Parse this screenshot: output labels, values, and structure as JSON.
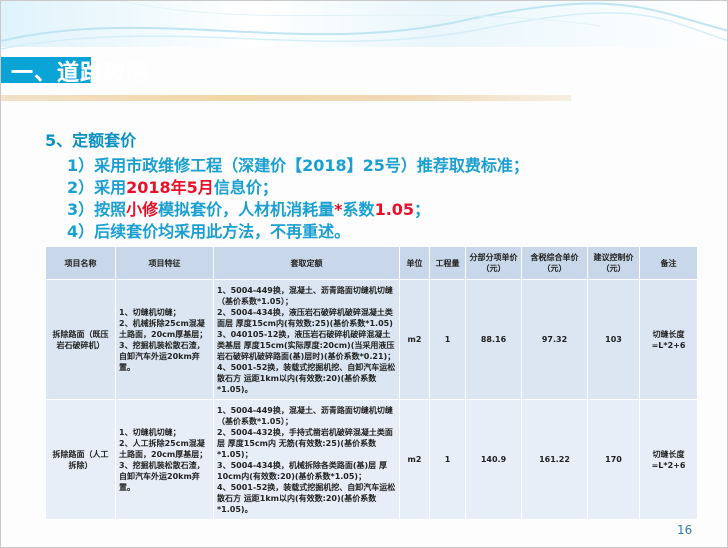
{
  "section_title": "一、道路破除",
  "subheading": "5、定额套价",
  "bullets": [
    {
      "prefix": "1）采用市政维修工程（深建价【2018】25号）推荐取费标准；"
    },
    {
      "prefix": "2）采用",
      "highlight": "2018年5月",
      "suffix": "信息价；"
    },
    {
      "prefix": "3）按照",
      "highlight": "小修",
      "middle": "模拟套价，人材机消耗量",
      "highlight2": "*",
      "middle2": "系数",
      "highlight3": "1.05",
      "suffix": "；"
    },
    {
      "prefix": "4）后续套价均采用此方法，不再重述。"
    }
  ],
  "table": {
    "headers": {
      "item_name": "项目名称",
      "item_feature": "项目特征",
      "quota": "套取定额",
      "unit": "单位",
      "quantity": "工程量",
      "sub_unit_price": "分部分项单价（元）",
      "composite_price": "含税综合单价（元）",
      "suggested_price": "建议控制价（元）",
      "remark": "备注"
    },
    "rows": [
      {
        "item_name": "拆除路面（既压岩石破碎机）",
        "item_feature": "1、切缝机切缝；\n2、机械拆除25cm混凝土路面，20cm厚基层；\n3、挖掘机装松散石渣，自卸汽车外运20km弃置。",
        "quota": "1、5004-449换，混凝土、沥青路面切缝机切缝（基价系数*1.05）；\n2、5004-434换，液压岩石破碎机破碎混凝土类面层 厚度15cm内(有效数:25)(基价系数*1.05)\n3、040105-12换，液压岩石破碎机破碎混凝土类基层 厚度15cm(实际厚度:20cm)(当采用液压岩石破碎机破碎路面(基)层时)(基价系数*0.21)；\n4、5001-52换，装载式挖掘机挖、自卸汽车运松散石方 运距1km以内(有效数:20)(基价系数*1.05)。",
        "unit": "m2",
        "quantity": "1",
        "sub_unit_price": "88.16",
        "composite_price": "97.32",
        "suggested_price": "103",
        "remark": "切缝长度=L*2+6"
      },
      {
        "item_name": "拆除路面（人工拆除）",
        "item_feature": "1、切缝机切缝；\n2、人工拆除25cm混凝土路面，20cm厚基层；\n3、挖掘机装松散石渣，自卸汽车外运20km弃置。",
        "quota": "1、5004-449换，混凝土、沥青路面切缝机切缝（基价系数*1.05）；\n2、5004-432换，手持式凿岩机破碎混凝土类面层 厚度15cm内 无筋(有效数:25)(基价系数*1.05)；\n3、5004-434换，机械拆除各类路面(基)层 厚10cm内(有效数:20)(基价系数*1.05)；\n4、5001-52换，装载式挖掘机挖、自卸汽车运松散石方 运距1km以内(有效数:20)(基价系数*1.05)。",
        "unit": "m2",
        "quantity": "1",
        "sub_unit_price": "140.9",
        "composite_price": "161.22",
        "suggested_price": "170",
        "remark": "切缝长度=L*2+6"
      }
    ]
  },
  "page_number": "16",
  "colors": {
    "title_bar": "#0aa3d6",
    "bullet_text": "#1a9fd0",
    "highlight": "#e8102a",
    "table_header": "#c8d8ea",
    "table_body": "#dbe6f2"
  }
}
